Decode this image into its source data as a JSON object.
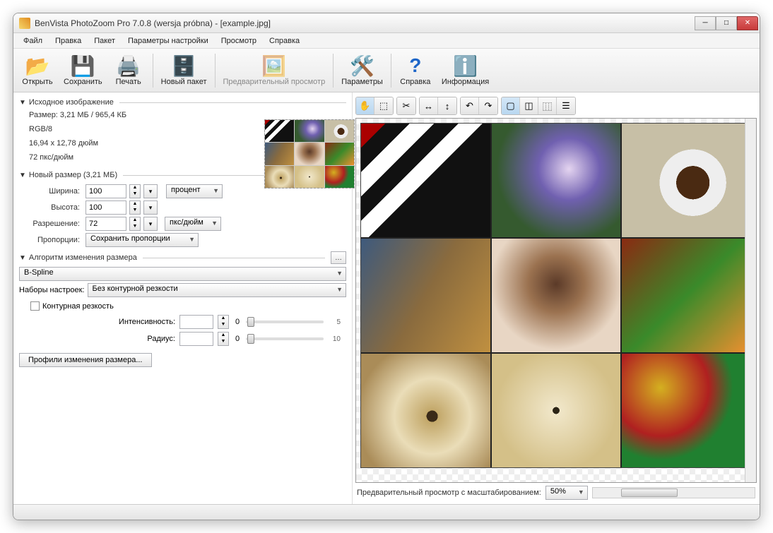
{
  "window": {
    "title": "BenVista PhotoZoom Pro 7.0.8 (wersja próbna) - [example.jpg]"
  },
  "menu": {
    "file": "Файл",
    "edit": "Правка",
    "batch": "Пакет",
    "settings": "Параметры настройки",
    "view": "Просмотр",
    "help": "Справка"
  },
  "toolbar": {
    "open": "Открыть",
    "save": "Сохранить",
    "print": "Печать",
    "newbatch": "Новый пакет",
    "preview": "Предварительный просмотр",
    "params": "Параметры",
    "help": "Справка",
    "info": "Информация"
  },
  "source": {
    "header": "Исходное изображение",
    "size": "Размер: 3,21 МБ / 965,4 КБ",
    "mode": "RGB/8",
    "dims": "16,94 x 12,78 дюйм",
    "res": "72 пкс/дюйм"
  },
  "newsize": {
    "header": "Новый размер (3,21 МБ)",
    "width_label": "Ширина:",
    "height_label": "Высота:",
    "res_label": "Разрешение:",
    "width": "100",
    "height": "100",
    "res": "72",
    "unit_percent": "процент",
    "unit_pxin": "пкс/дюйм",
    "aspect_label": "Пропорции:",
    "aspect_value": "Сохранить пропорции"
  },
  "resize_algo": {
    "header": "Алгоритм изменения размера",
    "method": "B-Spline",
    "presets_label": "Наборы настроек:",
    "presets_value": "Без контурной резкости",
    "unsharp_label": "Контурная резкость",
    "intensity_label": "Интенсивность:",
    "intensity_value": "0",
    "intensity_max": "5",
    "radius_label": "Радиус:",
    "radius_value": "0",
    "radius_max": "10",
    "profiles_btn": "Профили изменения размера..."
  },
  "preview": {
    "footer_label": "Предварительный просмотр с масштабированием:",
    "zoom": "50%"
  }
}
